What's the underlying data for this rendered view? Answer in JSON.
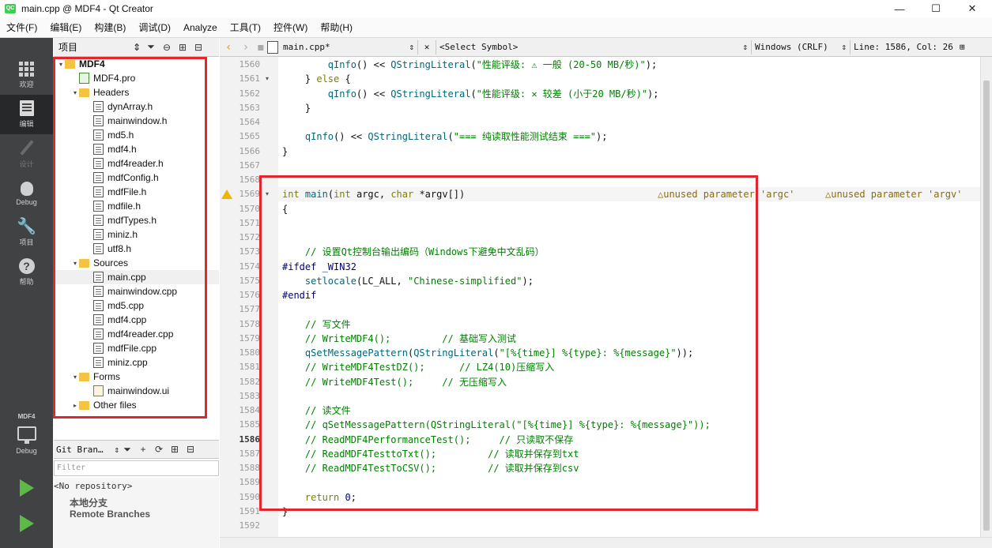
{
  "window": {
    "title": "main.cpp @ MDF4 - Qt Creator",
    "logo_text": "QC",
    "min_glyph": "—",
    "max_glyph": "☐",
    "close_glyph": "✕"
  },
  "menu": [
    "文件(F)",
    "编辑(E)",
    "构建(B)",
    "调试(D)",
    "Analyze",
    "工具(T)",
    "控件(W)",
    "帮助(H)"
  ],
  "modes": {
    "welcome": "欢迎",
    "edit": "编辑",
    "design": "设计",
    "debug": "Debug",
    "projects": "项目",
    "help": "帮助",
    "kit": "MDF4",
    "kit_mode": "Debug"
  },
  "projects_pane": {
    "view_combo": "项目",
    "tree": [
      {
        "label": "MDF4",
        "kind": "project",
        "depth": 0,
        "arrow": "▾"
      },
      {
        "label": "MDF4.pro",
        "kind": "pro",
        "depth": 1,
        "arrow": ""
      },
      {
        "label": "Headers",
        "kind": "folder",
        "depth": 1,
        "arrow": "▾"
      },
      {
        "label": "dynArray.h",
        "kind": "file",
        "depth": 2,
        "arrow": ""
      },
      {
        "label": "mainwindow.h",
        "kind": "file",
        "depth": 2,
        "arrow": ""
      },
      {
        "label": "md5.h",
        "kind": "file",
        "depth": 2,
        "arrow": ""
      },
      {
        "label": "mdf4.h",
        "kind": "file",
        "depth": 2,
        "arrow": ""
      },
      {
        "label": "mdf4reader.h",
        "kind": "file",
        "depth": 2,
        "arrow": ""
      },
      {
        "label": "mdfConfig.h",
        "kind": "file",
        "depth": 2,
        "arrow": ""
      },
      {
        "label": "mdfFile.h",
        "kind": "file",
        "depth": 2,
        "arrow": ""
      },
      {
        "label": "mdfile.h",
        "kind": "file",
        "depth": 2,
        "arrow": ""
      },
      {
        "label": "mdfTypes.h",
        "kind": "file",
        "depth": 2,
        "arrow": ""
      },
      {
        "label": "miniz.h",
        "kind": "file",
        "depth": 2,
        "arrow": ""
      },
      {
        "label": "utf8.h",
        "kind": "file",
        "depth": 2,
        "arrow": ""
      },
      {
        "label": "Sources",
        "kind": "folder",
        "depth": 1,
        "arrow": "▾"
      },
      {
        "label": "main.cpp",
        "kind": "file",
        "depth": 2,
        "arrow": "",
        "selected": true
      },
      {
        "label": "mainwindow.cpp",
        "kind": "file",
        "depth": 2,
        "arrow": ""
      },
      {
        "label": "md5.cpp",
        "kind": "file",
        "depth": 2,
        "arrow": ""
      },
      {
        "label": "mdf4.cpp",
        "kind": "file",
        "depth": 2,
        "arrow": ""
      },
      {
        "label": "mdf4reader.cpp",
        "kind": "file",
        "depth": 2,
        "arrow": ""
      },
      {
        "label": "mdfFile.cpp",
        "kind": "file",
        "depth": 2,
        "arrow": ""
      },
      {
        "label": "miniz.cpp",
        "kind": "file",
        "depth": 2,
        "arrow": ""
      },
      {
        "label": "Forms",
        "kind": "folder",
        "depth": 1,
        "arrow": "▾"
      },
      {
        "label": "mainwindow.ui",
        "kind": "ui",
        "depth": 2,
        "arrow": ""
      },
      {
        "label": "Other files",
        "kind": "folder",
        "depth": 1,
        "arrow": "▸"
      }
    ]
  },
  "git_pane": {
    "combo": "Git Bran…",
    "filter_placeholder": "Filter",
    "no_repo": "<No repository>",
    "local_branch": "本地分支",
    "remote_branches": "Remote Branches"
  },
  "editor_toolbar": {
    "file": "main.cpp*",
    "symbol": "<Select Symbol>",
    "line_ending": "Windows (CRLF)",
    "position": "Line: 1586, Col: 26"
  },
  "editor": {
    "current_line": 1586,
    "lines": [
      {
        "n": 1560,
        "text": "        qInfo() << QStringLiteral(\"性能评级: ⚠ 一般 (20-50 MB/秒)\");"
      },
      {
        "n": 1561,
        "text": "    } else {"
      },
      {
        "n": 1562,
        "text": "        qInfo() << QStringLiteral(\"性能评级: ✕ 较差 (小于20 MB/秒)\");"
      },
      {
        "n": 1563,
        "text": "    }"
      },
      {
        "n": 1564,
        "text": ""
      },
      {
        "n": 1565,
        "text": "    qInfo() << QStringLiteral(\"=== 纯读取性能测试结束 ===\");"
      },
      {
        "n": 1566,
        "text": "}"
      },
      {
        "n": 1567,
        "text": ""
      },
      {
        "n": 1568,
        "text": ""
      },
      {
        "n": 1569,
        "text": "int main(int argc, char *argv[])"
      },
      {
        "n": 1570,
        "text": "{"
      },
      {
        "n": 1571,
        "text": ""
      },
      {
        "n": 1572,
        "text": ""
      },
      {
        "n": 1573,
        "text": "    // 设置Qt控制台输出编码（Windows下避免中文乱码）"
      },
      {
        "n": 1574,
        "text": "#ifdef _WIN32"
      },
      {
        "n": 1575,
        "text": "    setlocale(LC_ALL, \"Chinese-simplified\");"
      },
      {
        "n": 1576,
        "text": "#endif"
      },
      {
        "n": 1577,
        "text": ""
      },
      {
        "n": 1578,
        "text": "    // 写文件"
      },
      {
        "n": 1579,
        "text": "    // WriteMDF4();         // 基础写入测试"
      },
      {
        "n": 1580,
        "text": "    qSetMessagePattern(QStringLiteral(\"[%{time}] %{type}: %{message}\"));"
      },
      {
        "n": 1581,
        "text": "    // WriteMDF4TestDZ();      // LZ4(10)压缩写入"
      },
      {
        "n": 1582,
        "text": "    // WriteMDF4Test();     // 无压缩写入"
      },
      {
        "n": 1583,
        "text": ""
      },
      {
        "n": 1584,
        "text": "    // 读文件"
      },
      {
        "n": 1585,
        "text": "    // qSetMessagePattern(QStringLiteral(\"[%{time}] %{type}: %{message}\"));"
      },
      {
        "n": 1586,
        "text": "    // ReadMDF4PerformanceTest();     // 只读取不保存"
      },
      {
        "n": 1587,
        "text": "    // ReadMDF4TesttoTxt();         // 读取并保存到txt"
      },
      {
        "n": 1588,
        "text": "    // ReadMDF4TestToCSV();         // 读取并保存到csv"
      },
      {
        "n": 1589,
        "text": ""
      },
      {
        "n": 1590,
        "text": "    return 0;"
      },
      {
        "n": 1591,
        "text": "}"
      },
      {
        "n": 1592,
        "text": ""
      }
    ],
    "warnings": [
      "unused parameter 'argc'",
      "unused parameter 'argv'"
    ]
  }
}
